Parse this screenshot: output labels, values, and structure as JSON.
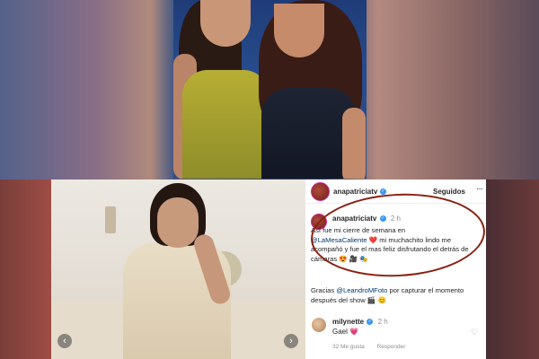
{
  "post": {
    "username": "anapatriciatv",
    "follow_label": "Seguidos",
    "more_label": "···",
    "time": "2 h",
    "line1": "Así fue mi cierre de semana en",
    "mention1": "@LaMesaCaliente",
    "heart": "❤️",
    "line2": " mi muchachito lindo me acompañó y fue el mas feliz disfrutando el detrás de cámaras 😍 🎥 🎭",
    "line3_pre": "Gracias ",
    "mention2": "@LeandroMFoto",
    "line3_post": " por capturar el momento después del show 🎬 😊"
  },
  "comment": {
    "username": "milynette",
    "time": "2 h",
    "text": "Gael",
    "heart": "💗",
    "likes": "32 Me gusta",
    "reply": "Responder",
    "like_icon": "heart-outline-icon"
  },
  "carousel": {
    "prev_icon": "‹",
    "next_icon": "›"
  },
  "colors": {
    "verified": "#3897f0",
    "mention": "#00376b",
    "annotation_circle": "#8a2010"
  }
}
